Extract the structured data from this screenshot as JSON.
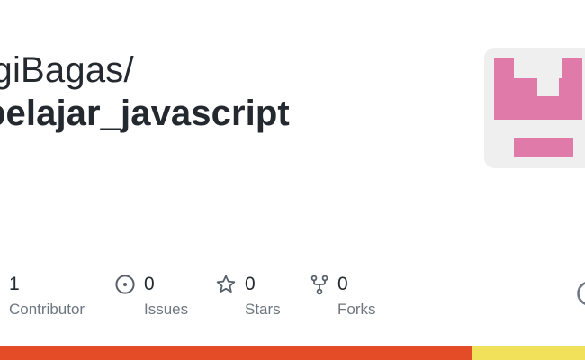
{
  "header": {
    "owner": "rgiBagas/",
    "repo": "belajar_javascript"
  },
  "avatar": {
    "background": "#efefef",
    "color": "#e07aa8"
  },
  "stats": [
    {
      "value": "1",
      "label": "Contributor",
      "icon": "people-icon"
    },
    {
      "value": "0",
      "label": "Issues",
      "icon": "issue-opened-icon"
    },
    {
      "value": "0",
      "label": "Stars",
      "icon": "star-icon"
    },
    {
      "value": "0",
      "label": "Forks",
      "icon": "repo-forked-icon"
    }
  ],
  "languages": [
    {
      "color": "#e34c26",
      "share": 0.807
    },
    {
      "color": "#f1e05a",
      "share": 0.193
    }
  ]
}
